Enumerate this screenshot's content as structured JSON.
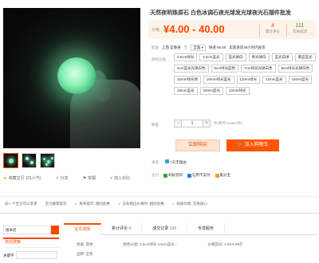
{
  "title": "天然夜明珠原石 白色冰调石夜光球发光球夜光石摆件批发",
  "price": {
    "label": "价格",
    "value": "¥4.00 - 40.00"
  },
  "stats": [
    {
      "value": "4",
      "label": "累计评价"
    },
    {
      "value": "111",
      "label": "交易成功"
    }
  ],
  "shipping": {
    "label": "配送",
    "from": "江西 宜春县",
    "to_label": "至",
    "to": "全国",
    "method": "快递 ¥6.00",
    "note": "卖家承诺48小时内发货"
  },
  "options": {
    "label": "颜色分类",
    "items": [
      "3.5cm绿光",
      "4.5cm蓝光",
      "蓝光球白",
      "青光球白",
      "蓝光白球",
      "黄蓝蓝光",
      "6cm蓝光光球白色",
      "6cm绿光蓝色",
      "7cm绿光光球白色",
      "8cm绿光光球白色",
      "10mm绿光球",
      "10mm绿光蓝光",
      "12mm绿光",
      "12mm蓝光",
      "16mm蓝光",
      "18mm蓝光",
      "20mm蓝光",
      "22mm绿光"
    ]
  },
  "quantity": {
    "label": "数量",
    "minus": "-",
    "value": "1",
    "plus": "+",
    "unit": "件",
    "stock": "(库存151667件)"
  },
  "buttons": {
    "buy": "立即购买",
    "cart": "加入购物车"
  },
  "promise": {
    "label": "承诺",
    "value": "7天无理由"
  },
  "payment": {
    "label": "支付",
    "methods": [
      "蚂蚁花呗",
      "信用卡支付",
      "集分宝"
    ]
  },
  "fav": {
    "collect": "收藏宝贝",
    "count": "(21人气)",
    "share": "分享",
    "report": "举报",
    "compare": "加入对比"
  },
  "notices": [
    "同一个宝贝可以享受",
    "宝贝跳转提示",
    "免单提示: 相同优惠",
    "没有相应价格时: 相同优惠",
    "快速付款: 交易放心"
  ],
  "sidebar": {
    "search_value": "搜本店",
    "shop_title": "本店搜索",
    "keyword_label": "关键字"
  },
  "tabs": [
    {
      "label": "宝贝详情",
      "count": ""
    },
    {
      "label": "累计评论",
      "count": "4"
    },
    {
      "label": "成交记录",
      "count": "134"
    },
    {
      "label": "专享服务",
      "count": ""
    }
  ],
  "attributes": [
    [
      "材质: 其他",
      "颜色分类: 3.5cm绿光 4.5cm蓝光...",
      "价格区间: 1.00-9.99元"
    ],
    [
      "品牌: 全新",
      "",
      ""
    ]
  ]
}
